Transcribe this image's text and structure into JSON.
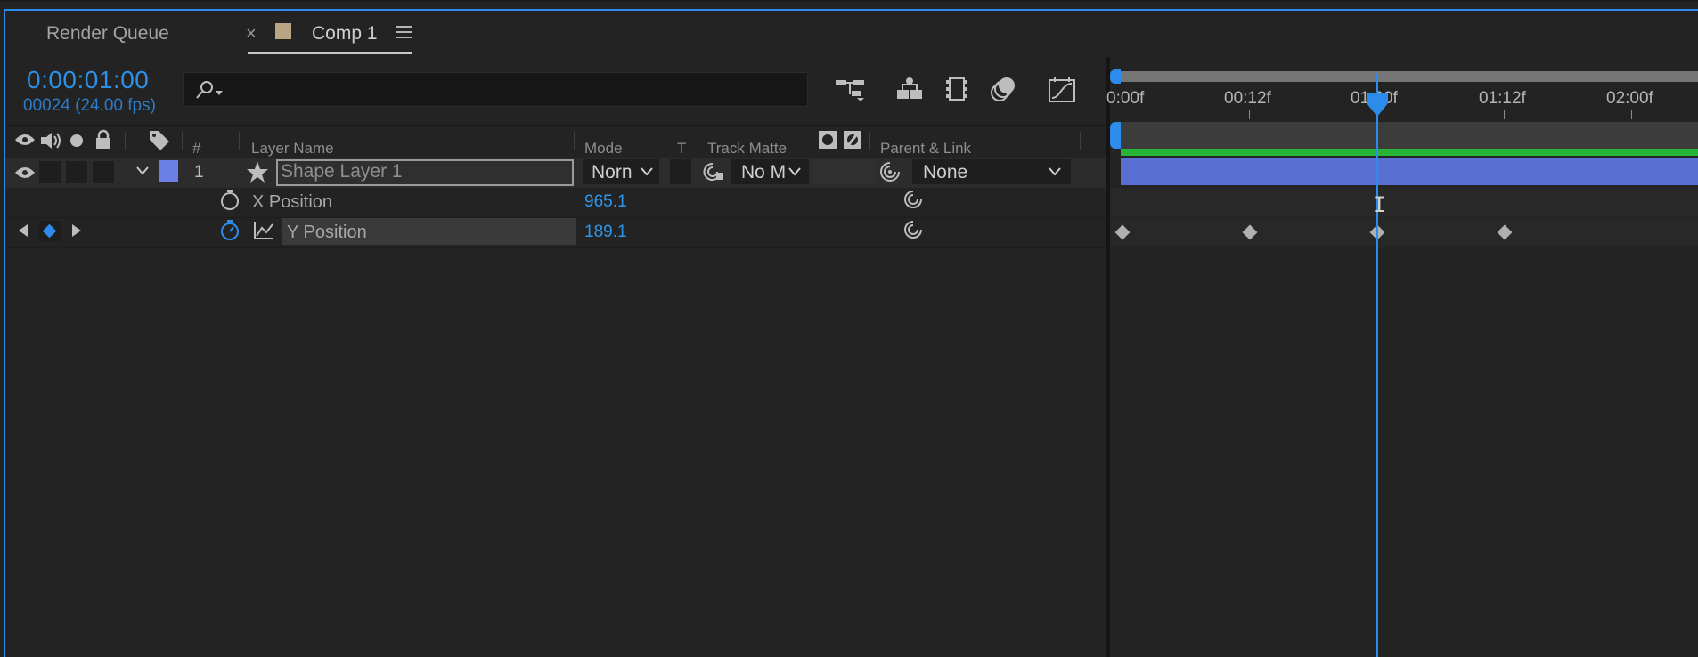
{
  "tabs": {
    "render_queue": "Render Queue",
    "close": "×",
    "comp": "Comp 1"
  },
  "time": {
    "timecode": "0:00:01:00",
    "frames": "00024 (24.00 fps)"
  },
  "search": {
    "placeholder": ""
  },
  "columns": {
    "num": "#",
    "layer_name": "Layer Name",
    "mode": "Mode",
    "t": "T",
    "track_matte": "Track Matte",
    "parent": "Parent & Link"
  },
  "layer": {
    "number": "1",
    "name": "Shape Layer 1",
    "mode": "Norn",
    "track_matte": "No M",
    "parent": "None",
    "label_color": "#6b7fe6"
  },
  "properties": [
    {
      "name": "X Position",
      "value": "965.1"
    },
    {
      "name": "Y Position",
      "value": "189.1"
    }
  ],
  "ruler": {
    "labels": [
      "0:00f",
      "00:12f",
      "01:00f",
      "01:12f",
      "02:00f"
    ]
  },
  "colors": {
    "accent": "#2d8ceb",
    "layer_bar": "#5a6fd2",
    "green_bar": "#28b436"
  }
}
